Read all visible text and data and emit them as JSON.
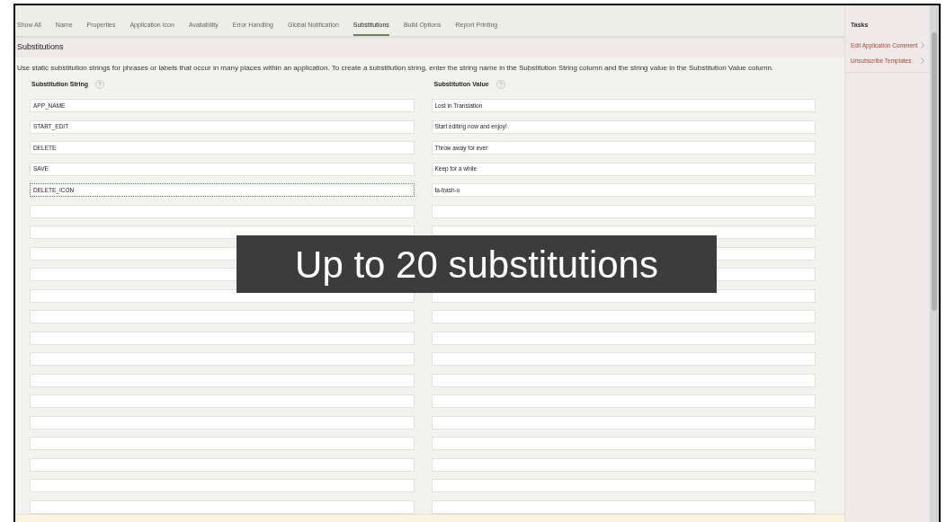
{
  "tabs": [
    {
      "label": "Show All",
      "selected": false
    },
    {
      "label": "Name",
      "selected": false
    },
    {
      "label": "Properties",
      "selected": false
    },
    {
      "label": "Application Icon",
      "selected": false
    },
    {
      "label": "Availability",
      "selected": false
    },
    {
      "label": "Error Handling",
      "selected": false
    },
    {
      "label": "Global Notification",
      "selected": false
    },
    {
      "label": "Substitutions",
      "selected": true
    },
    {
      "label": "Build Options",
      "selected": false
    },
    {
      "label": "Report Printing",
      "selected": false
    }
  ],
  "region": {
    "title": "Substitutions",
    "description": "Use static substitution strings for phrases or labels that occur in many places within an application. To create a substitution string, enter the string name in the Substitution String column and the string value in the Substitution Value column.",
    "columns": [
      "Substitution String",
      "Substitution Value"
    ],
    "rows": [
      {
        "string": "APP_NAME",
        "value": "Lost in Translation",
        "focused": false
      },
      {
        "string": "START_EDIT",
        "value": "Start editing now and enjoy!",
        "focused": false
      },
      {
        "string": "DELETE",
        "value": "Throw away for ever",
        "focused": false
      },
      {
        "string": "SAVE",
        "value": "Keep for a while",
        "focused": false
      },
      {
        "string": "DELETE_ICON",
        "value": "fa-trash-o",
        "focused": true
      },
      {
        "focused": false
      },
      {
        "focused": false
      },
      {
        "focused": false
      },
      {
        "focused": false
      },
      {
        "focused": false
      },
      {
        "focused": false
      },
      {
        "focused": false
      },
      {
        "focused": false
      },
      {
        "focused": false
      },
      {
        "focused": false
      },
      {
        "focused": false
      },
      {
        "focused": false
      },
      {
        "focused": false
      },
      {
        "focused": false
      },
      {
        "focused": false
      }
    ]
  },
  "tasks": {
    "title": "Tasks",
    "items": [
      "Edit Application Comment",
      "Unsubscribe Templates"
    ]
  },
  "caption": "Up to 20 substitutions"
}
